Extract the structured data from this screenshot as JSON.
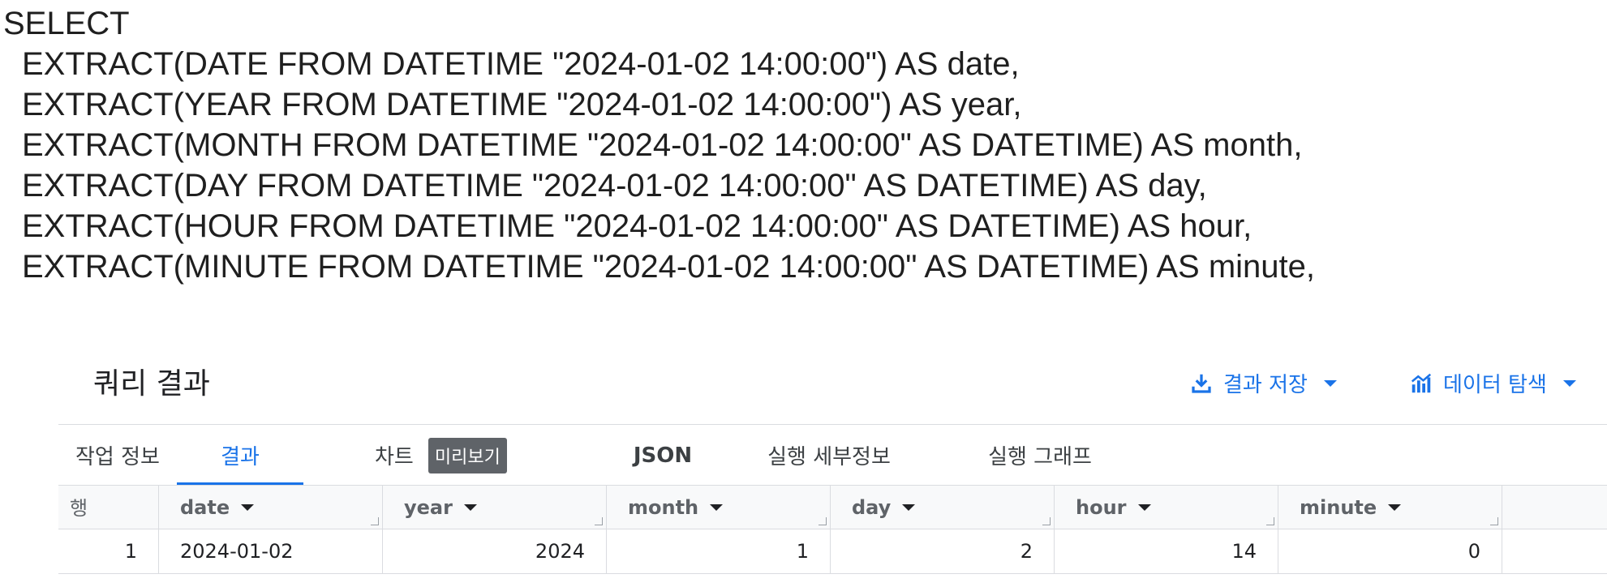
{
  "sql": {
    "lines": [
      "SELECT",
      "EXTRACT(DATE FROM DATETIME \"2024-01-02 14:00:00\") AS date,",
      "EXTRACT(YEAR FROM DATETIME \"2024-01-02 14:00:00\") AS year,",
      "EXTRACT(MONTH FROM DATETIME \"2024-01-02 14:00:00\" AS DATETIME) AS month,",
      "EXTRACT(DAY FROM DATETIME \"2024-01-02 14:00:00\" AS DATETIME) AS day,",
      "EXTRACT(HOUR FROM DATETIME \"2024-01-02 14:00:00\" AS DATETIME) AS hour,",
      "EXTRACT(MINUTE FROM DATETIME \"2024-01-02 14:00:00\" AS DATETIME) AS minute,"
    ]
  },
  "results_panel": {
    "title": "쿼리 결과",
    "save_label": "결과 저장",
    "explore_label": "데이터 탐색",
    "accent_color": "#1a73e8",
    "tabs": {
      "job_info": "작업 정보",
      "results": "결과",
      "chart": "차트",
      "preview_badge": "미리보기",
      "json": "JSON",
      "execution_details": "실행 세부정보",
      "execution_graph": "실행 그래프"
    }
  },
  "table": {
    "row_header": "행",
    "columns": [
      "date",
      "year",
      "month",
      "day",
      "hour",
      "minute"
    ],
    "rows": [
      {
        "row": "1",
        "date": "2024-01-02",
        "year": "2024",
        "month": "1",
        "day": "2",
        "hour": "14",
        "minute": "0"
      }
    ]
  }
}
